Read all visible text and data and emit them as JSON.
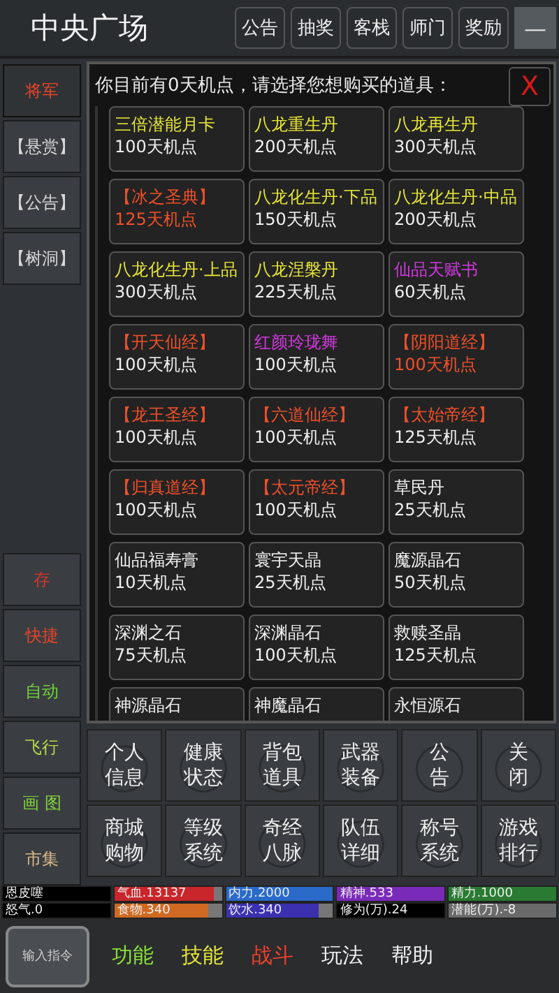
{
  "header": {
    "title": "中央广场",
    "buttons": [
      "公告",
      "抽奖",
      "客栈",
      "师门",
      "奖励"
    ],
    "menu_button": "—"
  },
  "sidebar_top": [
    {
      "label": "将军",
      "color": "#e8442a",
      "selected": true
    },
    {
      "label": "【悬赏】",
      "color": "#d8d8d8",
      "selected": false
    },
    {
      "label": "【公告】",
      "color": "#d8d8d8",
      "selected": false
    },
    {
      "label": "【树洞】",
      "color": "#d8d8d8",
      "selected": false
    }
  ],
  "sidebar_bottom": [
    {
      "label": "存",
      "color": "#d8352a"
    },
    {
      "label": "快捷",
      "color": "#e8442a"
    },
    {
      "label": "自动",
      "color": "#6fd23a"
    },
    {
      "label": "飞行",
      "color": "#b8d84a"
    },
    {
      "label": "画 图",
      "color": "#7fd43a"
    },
    {
      "label": "市集",
      "color": "#d8b88a"
    }
  ],
  "shop": {
    "prompt": "你目前有0天机点，请选择您想购买的道具：",
    "close": "X",
    "items": [
      {
        "name": "三倍潜能月卡",
        "price": "100天机点",
        "color": "#e6e63a",
        "price_highlighted": false
      },
      {
        "name": "八龙重生丹",
        "price": "200天机点",
        "color": "#e6e63a",
        "price_highlighted": false
      },
      {
        "name": "八龙再生丹",
        "price": "300天机点",
        "color": "#e6e63a",
        "price_highlighted": false
      },
      {
        "name": "【冰之圣典】",
        "price": "125天机点",
        "color": "#f0502a",
        "price_highlighted": true
      },
      {
        "name": "八龙化生丹·下品",
        "price": "150天机点",
        "color": "#e6e63a",
        "price_highlighted": false
      },
      {
        "name": "八龙化生丹·中品",
        "price": "200天机点",
        "color": "#e6e63a",
        "price_highlighted": false
      },
      {
        "name": "八龙化生丹·上品",
        "price": "300天机点",
        "color": "#e6e63a",
        "price_highlighted": false
      },
      {
        "name": "八龙涅槃丹",
        "price": "225天机点",
        "color": "#e6e63a",
        "price_highlighted": false
      },
      {
        "name": "仙品天赋书",
        "price": "60天机点",
        "color": "#d23ae0",
        "price_highlighted": false
      },
      {
        "name": "【开天仙经】",
        "price": "100天机点",
        "color": "#f0502a",
        "price_highlighted": false
      },
      {
        "name": "红颜玲珑舞",
        "price": "100天机点",
        "color": "#d23ae0",
        "price_highlighted": false
      },
      {
        "name": "【阴阳道经】",
        "price": "100天机点",
        "color": "#f0502a",
        "price_highlighted": true
      },
      {
        "name": "【龙王圣经】",
        "price": "100天机点",
        "color": "#f0502a",
        "price_highlighted": false
      },
      {
        "name": "【六道仙经】",
        "price": "100天机点",
        "color": "#f0502a",
        "price_highlighted": false
      },
      {
        "name": "【太始帝经】",
        "price": "125天机点",
        "color": "#f0502a",
        "price_highlighted": false
      },
      {
        "name": "【归真道经】",
        "price": "100天机点",
        "color": "#f0502a",
        "price_highlighted": false
      },
      {
        "name": "【太元帝经】",
        "price": "100天机点",
        "color": "#f0502a",
        "price_highlighted": false
      },
      {
        "name": "草民丹",
        "price": "25天机点",
        "color": "#f0f0f0",
        "price_highlighted": false
      },
      {
        "name": "仙品福寿膏",
        "price": "10天机点",
        "color": "#f0f0f0",
        "price_highlighted": false
      },
      {
        "name": "寰宇天晶",
        "price": "25天机点",
        "color": "#f0f0f0",
        "price_highlighted": false
      },
      {
        "name": "魔源晶石",
        "price": "50天机点",
        "color": "#f0f0f0",
        "price_highlighted": false
      },
      {
        "name": "深渊之石",
        "price": "75天机点",
        "color": "#f0f0f0",
        "price_highlighted": false
      },
      {
        "name": "深渊晶石",
        "price": "100天机点",
        "color": "#f0f0f0",
        "price_highlighted": false
      },
      {
        "name": "救赎圣晶",
        "price": "125天机点",
        "color": "#f0f0f0",
        "price_highlighted": false
      },
      {
        "name": "神源晶石",
        "color": "#f0f0f0"
      },
      {
        "name": "神魔晶石",
        "color": "#f0f0f0"
      },
      {
        "name": "永恒源石",
        "color": "#f0f0f0"
      }
    ]
  },
  "menu": [
    [
      "个人",
      "信息"
    ],
    [
      "健康",
      "状态"
    ],
    [
      "背包",
      "道具"
    ],
    [
      "武器",
      "装备"
    ],
    [
      "公",
      "告"
    ],
    [
      "关",
      "闭"
    ],
    [
      "商城",
      "购物"
    ],
    [
      "等级",
      "系统"
    ],
    [
      "奇经",
      "八脉"
    ],
    [
      "队伍",
      "详细"
    ],
    [
      "称号",
      "系统"
    ],
    [
      "游戏",
      "排行"
    ]
  ],
  "stats": [
    {
      "label": "恩皮噻",
      "color": "#000000",
      "level": 1
    },
    {
      "label": "气血.13137",
      "color": "#c8262a",
      "level": 0.93
    },
    {
      "label": "内力.2000",
      "color": "#2a6ac8",
      "level": 1
    },
    {
      "label": "精神.533",
      "color": "#7a2ab8",
      "level": 1
    },
    {
      "label": "精力.1000",
      "color": "#2a7a32",
      "level": 1
    },
    {
      "label": "怒气.0",
      "color": "#000000",
      "level": 1
    },
    {
      "label": "食物.340",
      "color": "#d06a22",
      "level": 0.87
    },
    {
      "label": "饮水.340",
      "color": "#3a30b0",
      "level": 0.86
    },
    {
      "label": "修为(万).24",
      "color": "#000000",
      "level": 1
    },
    {
      "label": "潜能(万).-8",
      "color": "#6a6a6a",
      "level": 1
    }
  ],
  "nav": {
    "command_key": "输入指令",
    "tabs": [
      {
        "label": "功能",
        "color": "#8ae03a"
      },
      {
        "label": "技能",
        "color": "#e6e63a"
      },
      {
        "label": "战斗",
        "color": "#f0402a"
      },
      {
        "label": "玩法",
        "color": "#f0f0f0"
      },
      {
        "label": "帮助",
        "color": "#f0f0f0"
      }
    ]
  }
}
